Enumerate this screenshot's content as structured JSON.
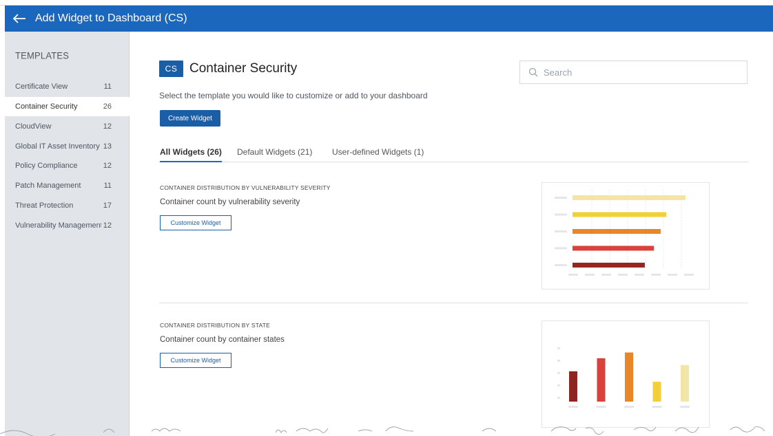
{
  "header": {
    "title": "Add Widget to Dashboard (CS)"
  },
  "sidebar": {
    "title": "TEMPLATES",
    "items": [
      {
        "label": "Certificate View",
        "count": "11"
      },
      {
        "label": "Container Security",
        "count": "26"
      },
      {
        "label": "CloudView",
        "count": "12"
      },
      {
        "label": "Global IT Asset Inventory",
        "count": "13"
      },
      {
        "label": "Policy Compliance",
        "count": "12"
      },
      {
        "label": "Patch Management",
        "count": "11"
      },
      {
        "label": "Threat Protection",
        "count": "17"
      },
      {
        "label": "Vulnerability Management",
        "count": "12"
      }
    ],
    "active_index": 1
  },
  "main": {
    "badge": "CS",
    "title": "Container Security",
    "search_placeholder": "Search",
    "subtitle": "Select the template you would like to customize or add to your dashboard",
    "create_button": "Create Widget",
    "tabs": [
      {
        "label": "All Widgets (26)",
        "active": true
      },
      {
        "label": "Default Widgets (21)",
        "active": false
      },
      {
        "label": "User-defined Widgets (1)",
        "active": false
      }
    ],
    "widgets": [
      {
        "code": "CONTAINER DISTRIBUTION BY VULNERABILITY SEVERITY",
        "description": "Container count by vulnerability severity",
        "button": "Customize Widget"
      },
      {
        "code": "CONTAINER DISTRIBUTION BY STATE",
        "description": "Container count by container states",
        "button": "Customize Widget"
      }
    ]
  },
  "previews": {
    "severity_bars": [
      {
        "value": 1.0,
        "color": "#f4e5a4"
      },
      {
        "value": 0.83,
        "color": "#f5cf3a"
      },
      {
        "value": 0.78,
        "color": "#e8872a"
      },
      {
        "value": 0.72,
        "color": "#d9413a"
      },
      {
        "value": 0.64,
        "color": "#95271f"
      }
    ],
    "state_bars": [
      {
        "value": 0.58,
        "color": "#8f2420"
      },
      {
        "value": 0.83,
        "color": "#d9413a"
      },
      {
        "value": 0.94,
        "color": "#e8872a"
      },
      {
        "value": 0.38,
        "color": "#f5cf3a"
      },
      {
        "value": 0.7,
        "color": "#f2e6a7"
      }
    ]
  },
  "colors": {
    "accent": "#1b67be",
    "sidebar_bg": "#e1e5ea"
  }
}
